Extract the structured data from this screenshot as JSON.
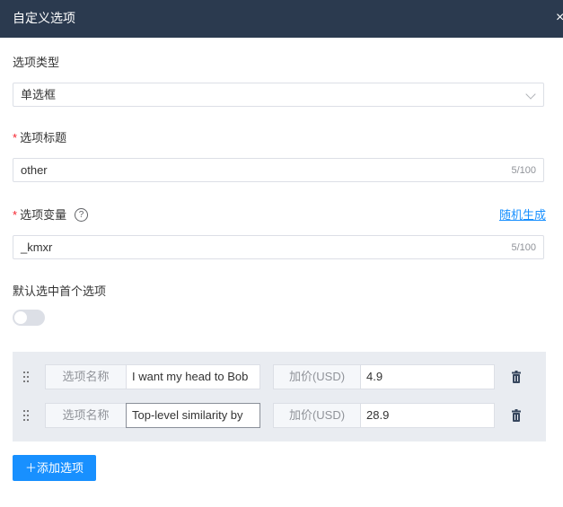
{
  "dialog": {
    "title": "自定义选项",
    "close_glyph": "×"
  },
  "option_type": {
    "label": "选项类型",
    "value": "单选框"
  },
  "option_title": {
    "required_mark": "*",
    "label": "选项标题",
    "value": "other",
    "counter": "5/100"
  },
  "option_variable": {
    "required_mark": "*",
    "label": "选项变量",
    "help_glyph": "?",
    "random_link": "随机生成",
    "value": "_kmxr",
    "counter": "5/100"
  },
  "default_first": {
    "label": "默认选中首个选项",
    "enabled": false
  },
  "options": [
    {
      "name_label": "选项名称",
      "name_value": "I want my head to Bob",
      "price_label": "加价(USD)",
      "price_value": "4.9"
    },
    {
      "name_label": "选项名称",
      "name_value": "Top-level similarity by",
      "price_label": "加价(USD)",
      "price_value": "28.9"
    }
  ],
  "add_option_button": {
    "label": "＋添加选项"
  },
  "colors": {
    "header": "#2b3a4f",
    "accent": "#1890ff",
    "required": "#f5222d",
    "panel": "#e9ecf1"
  }
}
